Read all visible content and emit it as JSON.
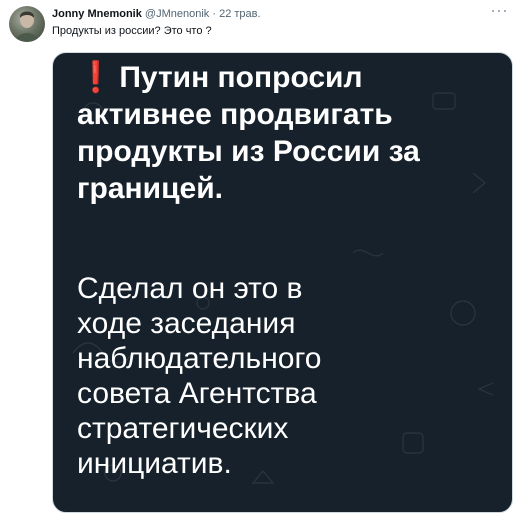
{
  "author": {
    "name": "Jonny Mnemonik",
    "handle": "@JMnenonik",
    "separator": "·",
    "time": "22 трав."
  },
  "tweet": {
    "text": "Продукты из россии? Это что ?"
  },
  "media": {
    "headline_icon": "red-exclamation-icon",
    "headline_icon_glyph": "❗",
    "headline_lines": [
      "Путин попросил",
      "активнее продвигать",
      "продукты из России за",
      "границей."
    ],
    "body_lines": [
      "Сделал он это в",
      "ходе заседания",
      "наблюдательного",
      "совета Агентства",
      "стратегических",
      "инициатив."
    ]
  },
  "colors": {
    "media_background": "#17212b",
    "exclamation": "#e0261b",
    "name_text": "#0f1419",
    "meta_text": "#536471"
  }
}
